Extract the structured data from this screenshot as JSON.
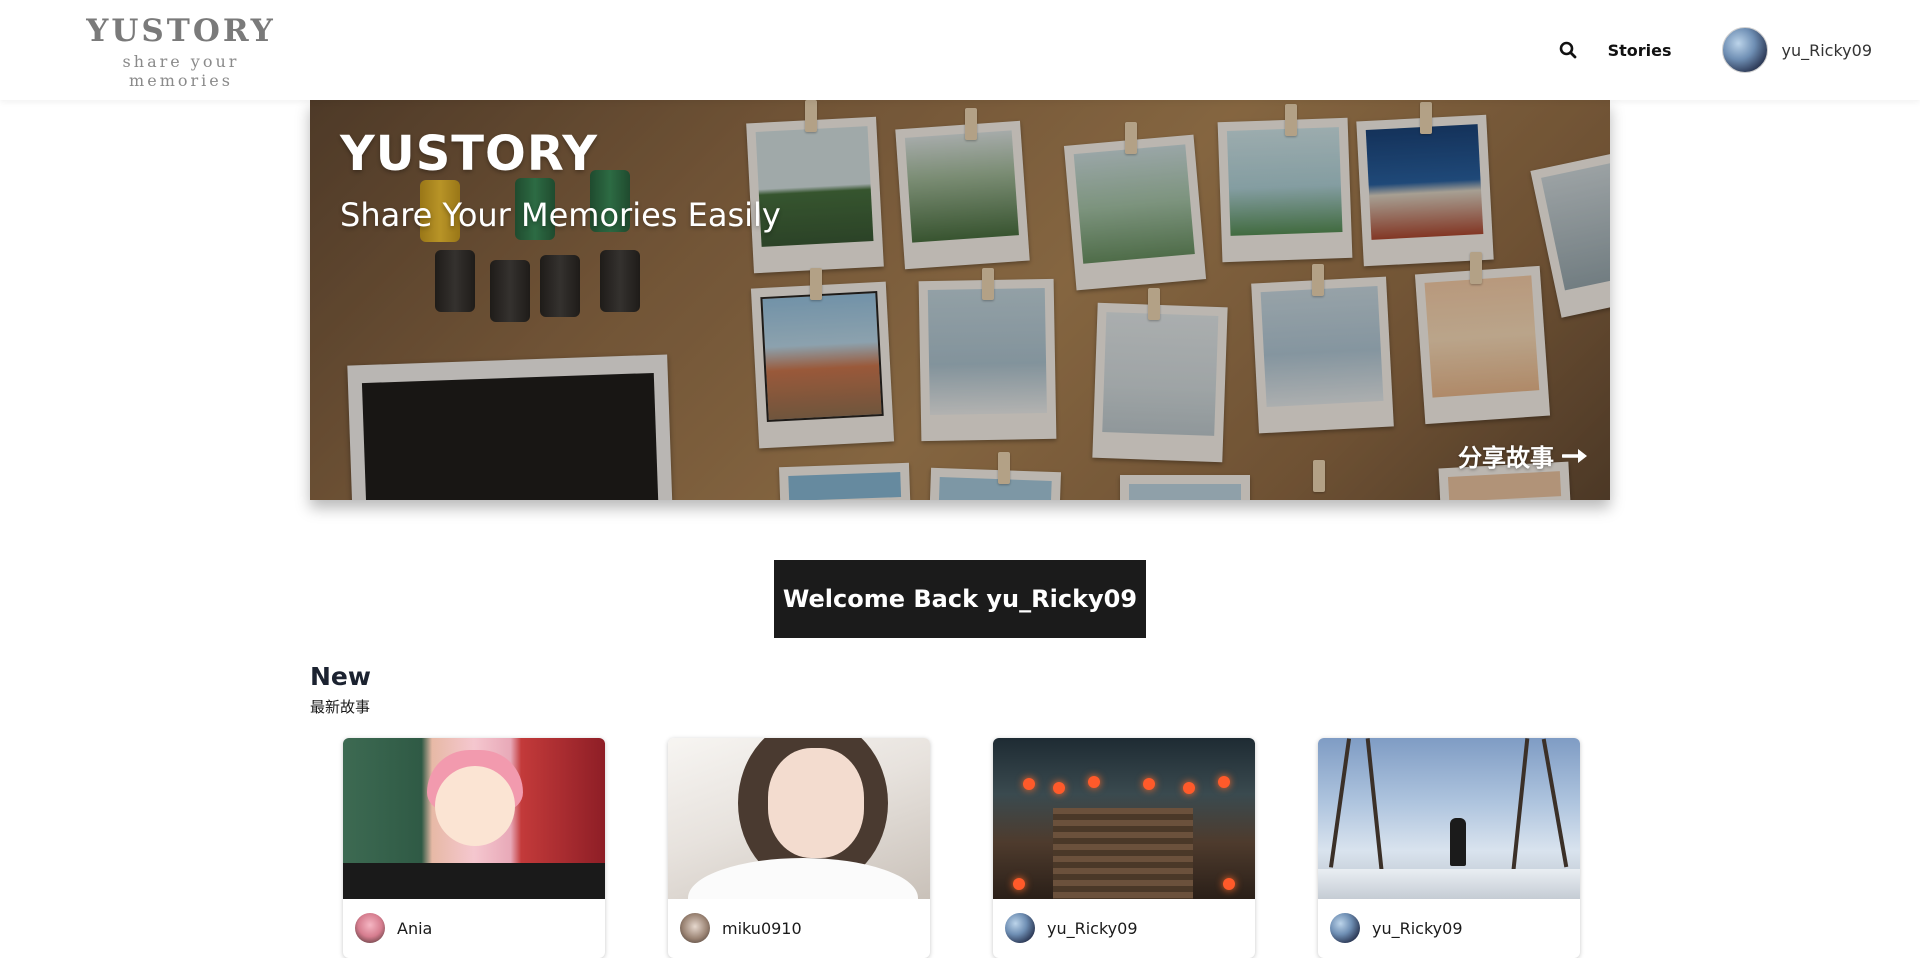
{
  "header": {
    "logo_title": "YUSTORY",
    "logo_subtitle": "share your memories",
    "nav_stories": "Stories",
    "username": "yu_Ricky09",
    "search_icon": "search-icon"
  },
  "hero": {
    "title": "YUSTORY",
    "subtitle": "Share Your Memories Easily",
    "cta_label": "分享故事",
    "cta_icon": "arrow-right-icon"
  },
  "welcome": {
    "label": "Welcome Back yu_Ricky09"
  },
  "new_section": {
    "title": "New",
    "subtitle": "最新故事",
    "cards": [
      {
        "author": "Ania"
      },
      {
        "author": "miku0910"
      },
      {
        "author": "yu_Ricky09"
      },
      {
        "author": "yu_Ricky09"
      }
    ]
  },
  "colors": {
    "primary_dark": "#1b1b1b",
    "background": "#ffffff",
    "logo_gray": "#7a7a7a"
  }
}
